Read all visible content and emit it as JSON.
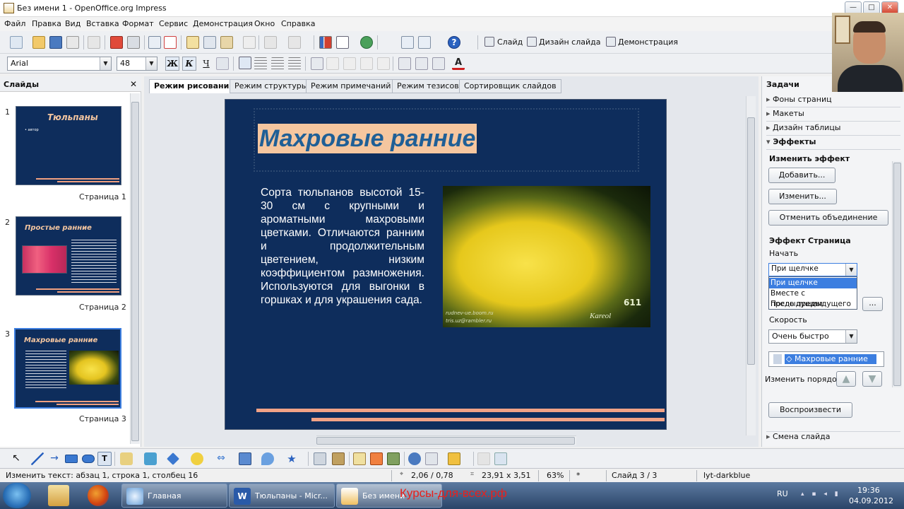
{
  "window": {
    "title": "Без имени 1 - OpenOffice.org Impress",
    "minimize": "—",
    "maximize": "□",
    "close": "✕"
  },
  "menu": [
    "Файл",
    "Правка",
    "Вид",
    "Вставка",
    "Формат",
    "Сервис",
    "Демонстрация",
    "Окно",
    "Справка"
  ],
  "toolbar": {
    "slide_label": "Слайд",
    "design_label": "Дизайн слайда",
    "show_label": "Демонстрация",
    "font_name": "Arial",
    "font_size": "48",
    "bold": "Ж",
    "italic": "К",
    "underline": "Ч"
  },
  "slides_panel": {
    "title": "Слайды",
    "close": "✕",
    "slides": [
      {
        "num": "1",
        "title": "Тюльпаны",
        "bullet": "• автор",
        "page": "Страница 1"
      },
      {
        "num": "2",
        "title": "Простые ранние",
        "page": "Страница 2"
      },
      {
        "num": "3",
        "title": "Махровые ранние",
        "page": "Страница 3"
      }
    ]
  },
  "view_tabs": [
    "Режим рисования",
    "Режим структуры",
    "Режим примечаний",
    "Режим тезисов",
    "Сортировщик слайдов"
  ],
  "slide": {
    "title": "Махровые ранние",
    "body": "Сорта тюльпанов высотой 15-30 см с крупными и ароматными махровыми цветками. Отличаются ранним и продолжительным цветением, низким коэффициентом размножения. Используются для выгонки в горшках и для украшения сада.",
    "photo_num": "611",
    "photo_brand": "Kareol",
    "photo_wm1": "rudnev-ue.boom.ru",
    "photo_wm2": "tris.uz@rambler.ru"
  },
  "tasks": {
    "title": "Задачи",
    "close": "✕",
    "sections": [
      "Фоны страниц",
      "Макеты",
      "Дизайн таблицы",
      "Эффекты"
    ],
    "change_effect": "Изменить эффект",
    "add": "Добавить...",
    "change": "Изменить...",
    "cancel_merge": "Отменить объединение",
    "effect_group": "Эффект Страница",
    "start_label": "Начать",
    "start_value": "При щелчке",
    "start_options": [
      "При щелчке",
      "Вместе с предыдущим",
      "После предыдущего"
    ],
    "more": "...",
    "speed_label": "Скорость",
    "speed_value": "Очень быстро",
    "effect_item": "Махровые ранние",
    "order_label": "Изменить порядок:",
    "play": "Воспроизвести",
    "slide_change": "Смена слайда"
  },
  "status": {
    "text": "Изменить текст: абзац 1, строка 1, столбец 16",
    "pos": "2,06 / 0,78",
    "size": "23,91 x 3,51",
    "zoom": "63%",
    "modified": "*",
    "slide": "Слайд 3 / 3",
    "layout": "lyt-darkblue"
  },
  "taskbar": {
    "items": [
      "Главная",
      "Тюльпаны - Micr...",
      "Без имени"
    ],
    "overlay": "Курсы-для-всех.рф",
    "lang": "RU",
    "time": "19:36",
    "date": "04.09.2012"
  },
  "colors": {
    "slide_bg": "#0e2d5c",
    "title_text": "#1f5f96",
    "title_highlight": "#f5c69f",
    "accent_line": "#f2a286",
    "overlay_text": "#e8201c"
  }
}
